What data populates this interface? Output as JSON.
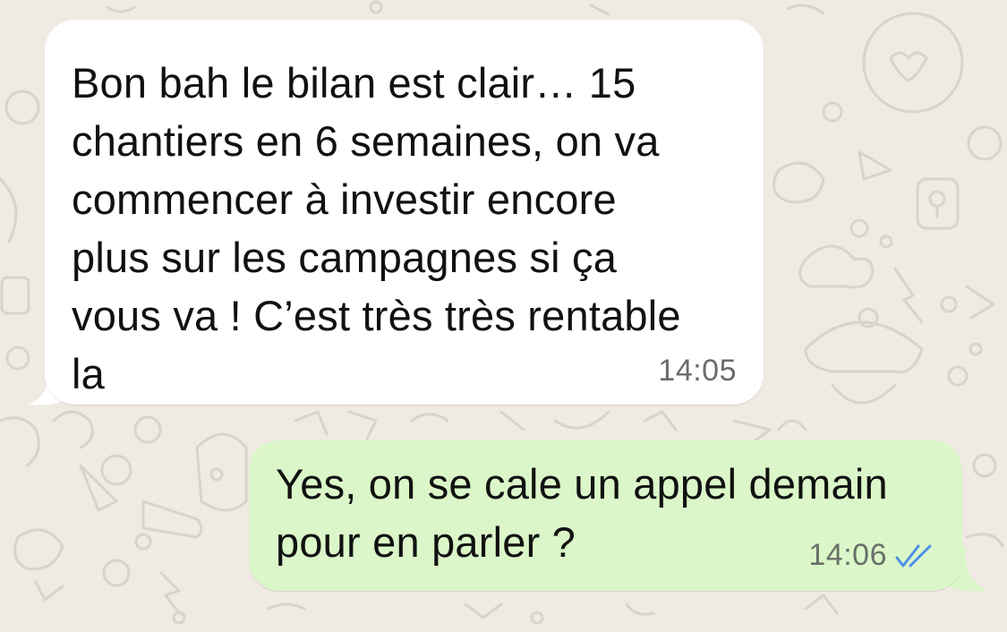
{
  "chat": {
    "messages": [
      {
        "direction": "incoming",
        "text": "Bon bah le bilan est clair… 15\nchantiers en 6 semaines, on va\ncommencer à investir encore\nplus sur les campagnes si ça\nvous va ! C’est très très rentable\nla",
        "time": "14:05"
      },
      {
        "direction": "outgoing",
        "text": "Yes, on se cale un appel demain\npour en parler ?",
        "time": "14:06",
        "status_icon": "double-check-read-icon"
      }
    ]
  },
  "colors": {
    "wallpaper": "#efeae2",
    "incoming_bubble": "#ffffff",
    "outgoing_bubble": "#dbf7c9",
    "read_ticks": "#4f8fe8"
  }
}
